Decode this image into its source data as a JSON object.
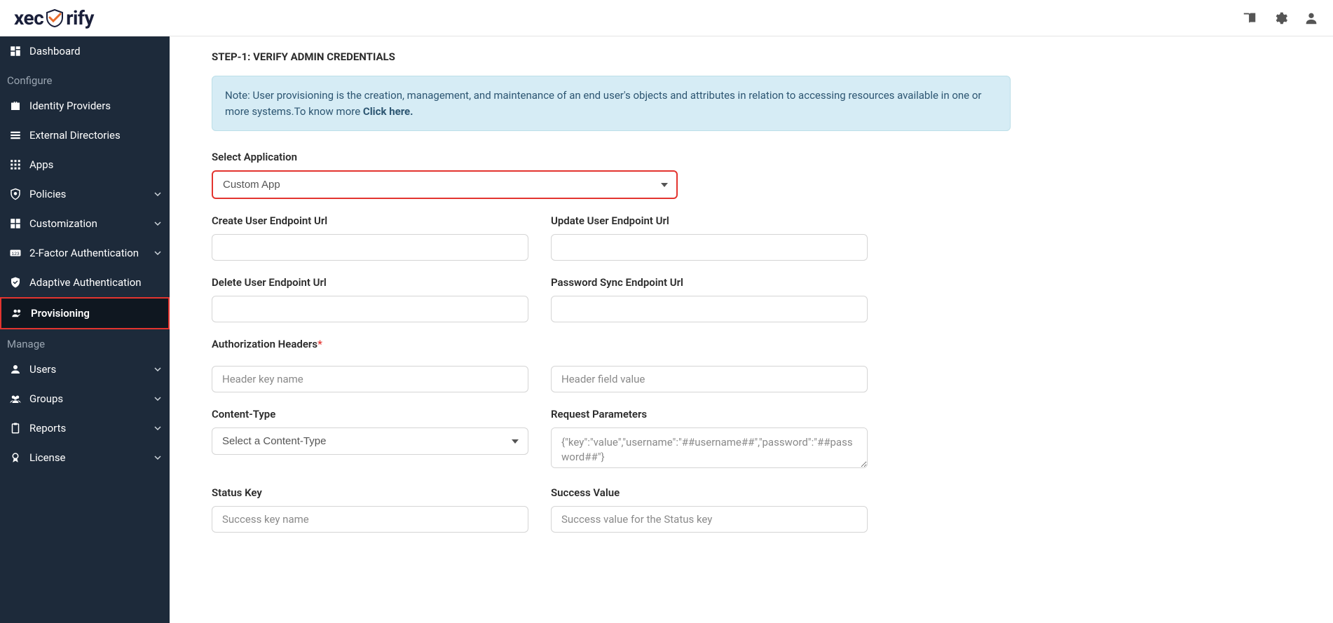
{
  "brand": {
    "pre": "xec",
    "post": "rify"
  },
  "sidebar": {
    "items": [
      {
        "label": "Dashboard",
        "icon": "dashboard",
        "section": null,
        "expandable": false,
        "active": false
      },
      {
        "label": "Configure",
        "section": true
      },
      {
        "label": "Identity Providers",
        "icon": "briefcase",
        "expandable": false,
        "active": false
      },
      {
        "label": "External Directories",
        "icon": "list",
        "expandable": false,
        "active": false
      },
      {
        "label": "Apps",
        "icon": "grid",
        "expandable": false,
        "active": false
      },
      {
        "label": "Policies",
        "icon": "shield-o",
        "expandable": true,
        "active": false
      },
      {
        "label": "Customization",
        "icon": "puzzle",
        "expandable": true,
        "active": false
      },
      {
        "label": "2-Factor Authentication",
        "icon": "numbers",
        "expandable": true,
        "active": false
      },
      {
        "label": "Adaptive Authentication",
        "icon": "shield-check",
        "expandable": false,
        "active": false
      },
      {
        "label": "Provisioning",
        "icon": "users-sync",
        "expandable": false,
        "active": true
      },
      {
        "label": "Manage",
        "section": true
      },
      {
        "label": "Users",
        "icon": "user",
        "expandable": true,
        "active": false
      },
      {
        "label": "Groups",
        "icon": "group",
        "expandable": true,
        "active": false
      },
      {
        "label": "Reports",
        "icon": "clipboard",
        "expandable": true,
        "active": false
      },
      {
        "label": "License",
        "icon": "ribbon",
        "expandable": true,
        "active": false
      }
    ]
  },
  "main": {
    "step_title": "STEP-1: VERIFY ADMIN CREDENTIALS",
    "note_prefix": "Note: User provisioning is the creation, management, and maintenance of an end user's objects and attributes in relation to accessing resources available in one or more systems.To know more ",
    "note_link": "Click here.",
    "select_app_label": "Select Application",
    "select_app_value": "Custom App",
    "fields": {
      "create_url": {
        "label": "Create User Endpoint Url",
        "value": ""
      },
      "update_url": {
        "label": "Update User Endpoint Url",
        "value": ""
      },
      "delete_url": {
        "label": "Delete User Endpoint Url",
        "value": ""
      },
      "password_url": {
        "label": "Password Sync Endpoint Url",
        "value": ""
      },
      "auth_headers": {
        "label": "Authorization Headers"
      },
      "header_key": {
        "placeholder": "Header key name",
        "value": ""
      },
      "header_value": {
        "placeholder": "Header field value",
        "value": ""
      },
      "content_type": {
        "label": "Content-Type",
        "placeholder": "Select a Content-Type"
      },
      "request_params": {
        "label": "Request Parameters",
        "placeholder": "{\"key\":\"value\",\"username\":\"##username##\",\"password\":\"##password##\"}",
        "value": ""
      },
      "status_key": {
        "label": "Status Key",
        "placeholder": "Success key name",
        "value": ""
      },
      "success_value": {
        "label": "Success Value",
        "placeholder": "Success value for the Status key",
        "value": ""
      }
    }
  }
}
